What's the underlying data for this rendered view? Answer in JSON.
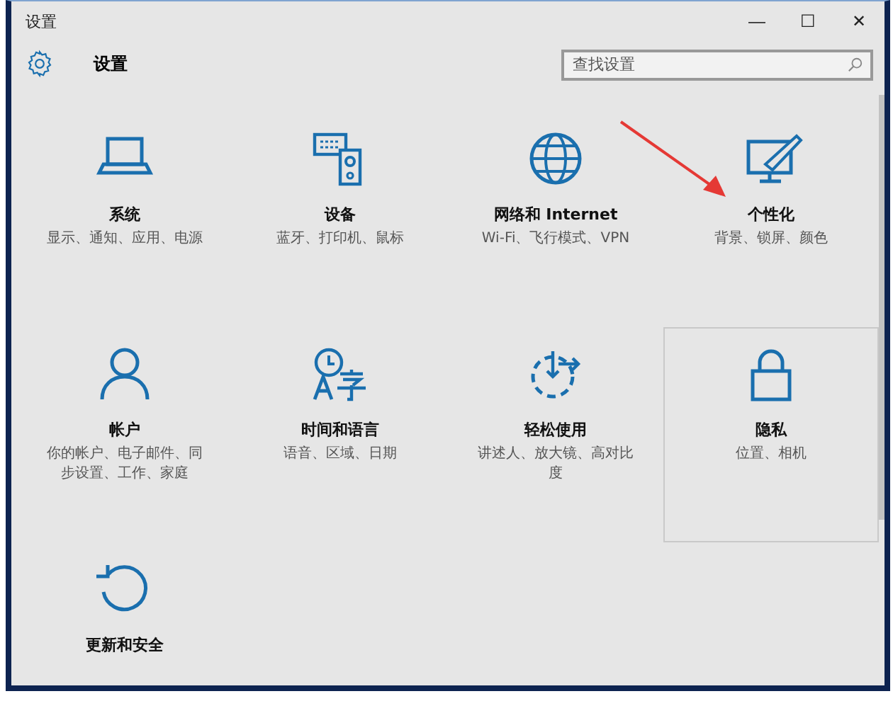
{
  "window": {
    "title": "设置",
    "controls": [
      "—",
      "☐",
      "✕"
    ]
  },
  "header": {
    "title": "设置",
    "search": {
      "placeholder": "查找设置"
    }
  },
  "tiles": [
    {
      "kind": "laptop",
      "name": "系统",
      "description": "显示、通知、应用、电源",
      "highlighted": false
    },
    {
      "kind": "devices",
      "name": "设备",
      "description": "蓝牙、打印机、鼠标",
      "highlighted": false
    },
    {
      "kind": "globe",
      "name": "网络和 Internet",
      "description": "Wi-Fi、飞行模式、VPN",
      "highlighted": false
    },
    {
      "kind": "brush",
      "name": "个性化",
      "description": "背景、锁屏、颜色",
      "highlighted": false
    },
    {
      "kind": "person",
      "name": "帐户",
      "description": "你的帐户、电子邮件、同步设置、工作、家庭",
      "highlighted": false
    },
    {
      "kind": "language",
      "name": "时间和语言",
      "description": "语音、区域、日期",
      "highlighted": false
    },
    {
      "kind": "ease",
      "name": "轻松使用",
      "description": "讲述人、放大镜、高对比度",
      "highlighted": false
    },
    {
      "kind": "lock",
      "name": "隐私",
      "description": "位置、相机",
      "highlighted": true
    },
    {
      "kind": "update",
      "name": "更新和安全",
      "highlighted": false
    }
  ]
}
